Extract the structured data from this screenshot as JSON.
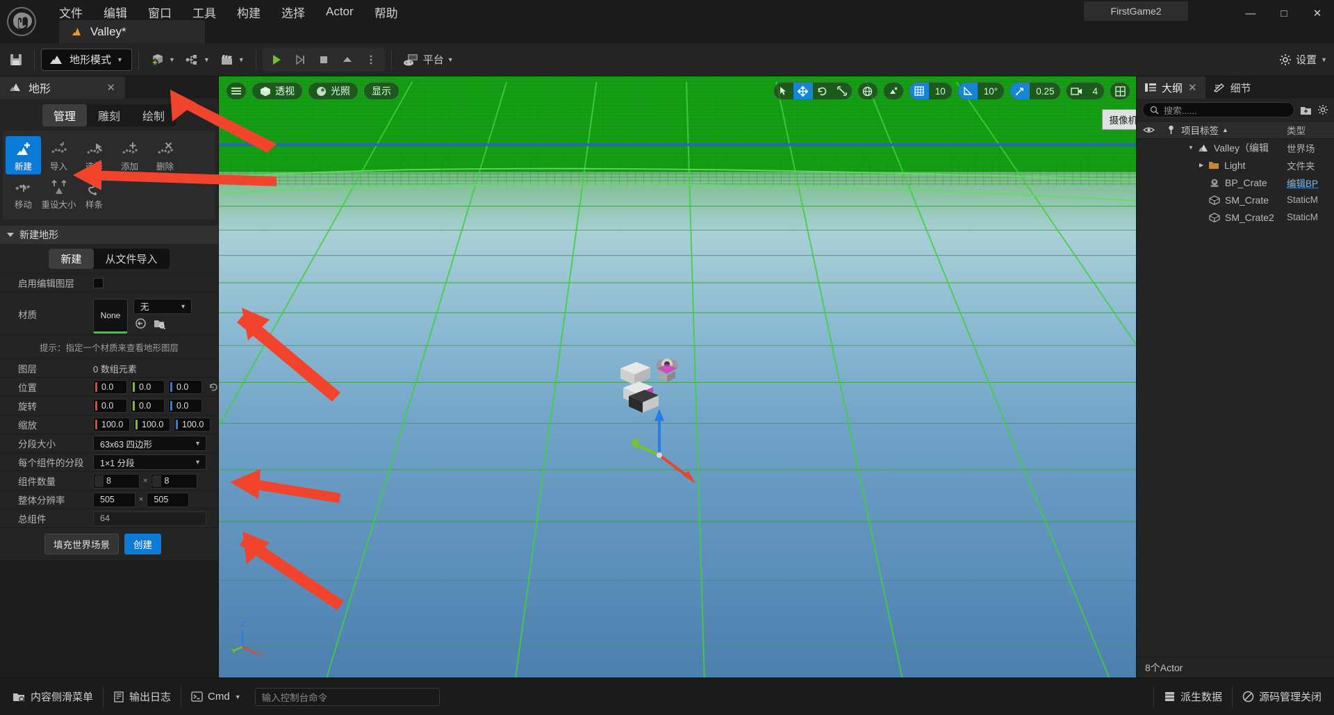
{
  "titlebar": {
    "menus": [
      "文件",
      "编辑",
      "窗口",
      "工具",
      "构建",
      "选择",
      "Actor",
      "帮助"
    ],
    "tab_label": "Valley*",
    "project_name": "FirstGame2",
    "minimize": "—",
    "maximize": "□",
    "close": "✕"
  },
  "toolbar": {
    "save_tip": "保存",
    "mode_label": "地形模式",
    "platform_label": "平台",
    "settings_label": "设置"
  },
  "landscape_panel": {
    "tab_title": "地形",
    "close": "✕",
    "segments": [
      "管理",
      "雕刻",
      "绘制"
    ],
    "active_segment": "管理",
    "tools": [
      {
        "label": "新建",
        "active": true
      },
      {
        "label": "导入",
        "active": false
      },
      {
        "label": "选择",
        "active": false
      },
      {
        "label": "添加",
        "active": false
      },
      {
        "label": "删除",
        "active": false
      },
      {
        "label": "移动",
        "active": false
      },
      {
        "label": "重设大小",
        "active": false
      },
      {
        "label": "样条",
        "active": false
      }
    ],
    "section_title": "新建地形",
    "mode_tabs": [
      "新建",
      "从文件导入"
    ],
    "mode_tab_active": "新建",
    "rows": {
      "enable_edit_layers_label": "启用编辑图层",
      "material_label": "材质",
      "material_value": "None",
      "material_dropdown": "无",
      "hint": "提示：指定一个材质来查看地形图层",
      "layers_label": "图层",
      "layers_value": "0 数组元素",
      "location_label": "位置",
      "location": [
        "0.0",
        "0.0",
        "0.0"
      ],
      "rotation_label": "旋转",
      "rotation": [
        "0.0",
        "0.0",
        "0.0"
      ],
      "scale_label": "缩放",
      "scale": [
        "100.0",
        "100.0",
        "100.0"
      ],
      "section_size_label": "分段大小",
      "section_size_value": "63x63 四边形",
      "sections_per_component_label": "每个组件的分段",
      "sections_per_component_value": "1×1 分段",
      "component_count_label": "组件数量",
      "component_count_x": "8",
      "component_count_y": "8",
      "resolution_label": "整体分辨率",
      "resolution_x": "505",
      "resolution_y": "505",
      "total_components_label": "总组件",
      "total_components_value": "64",
      "times": "×"
    },
    "fill_world_button": "填充世界场景",
    "create_button": "创建"
  },
  "viewport": {
    "perspective_label": "透视",
    "lit_label": "光照",
    "show_label": "显示",
    "grid_snap_value": "10",
    "angle_snap_value": "10°",
    "scale_snap_value": "0.25",
    "camera_speed_value": "4",
    "tooltip": "摄像机速度",
    "axis_x": "X",
    "axis_y": "Y",
    "axis_z": "Z"
  },
  "outliner": {
    "tabs": [
      {
        "label": "大纲",
        "active": true
      },
      {
        "label": "细节",
        "active": false
      }
    ],
    "close": "✕",
    "search_placeholder": "搜索......",
    "col_name": "项目标签",
    "col_type": "类型",
    "sort_arrow": "▲",
    "rows": [
      {
        "name": "Valley（编辑",
        "type": "世界场",
        "indent": 0,
        "icon": "landscape-icon",
        "expanded": true,
        "link": false
      },
      {
        "name": "Light",
        "type": "文件夹",
        "indent": 1,
        "icon": "folder-icon",
        "expanded": false,
        "link": false
      },
      {
        "name": "BP_Crate",
        "type": "编辑BP",
        "indent": 2,
        "icon": "blueprint-icon",
        "expanded": null,
        "link": true
      },
      {
        "name": "SM_Crate",
        "type": "StaticM",
        "indent": 2,
        "icon": "mesh-icon",
        "expanded": null,
        "link": false
      },
      {
        "name": "SM_Crate2",
        "type": "StaticM",
        "indent": 2,
        "icon": "mesh-icon",
        "expanded": null,
        "link": false
      }
    ],
    "footer": "8个Actor"
  },
  "statusbar": {
    "content_drawer": "内容侧滑菜单",
    "output_log": "输出日志",
    "cmd_label": "Cmd",
    "cmd_placeholder": "输入控制台命令",
    "derived_data": "派生数据",
    "source_control": "源码管理关闭"
  },
  "colors": {
    "accent_blue": "#0c7bd8",
    "arrow_red": "#f2442c",
    "axis_x": "#e8452b",
    "axis_y": "#7bc225",
    "axis_z": "#2b7be8",
    "terrain_green": "#18a018",
    "sky_blue": "#5b86b8"
  }
}
